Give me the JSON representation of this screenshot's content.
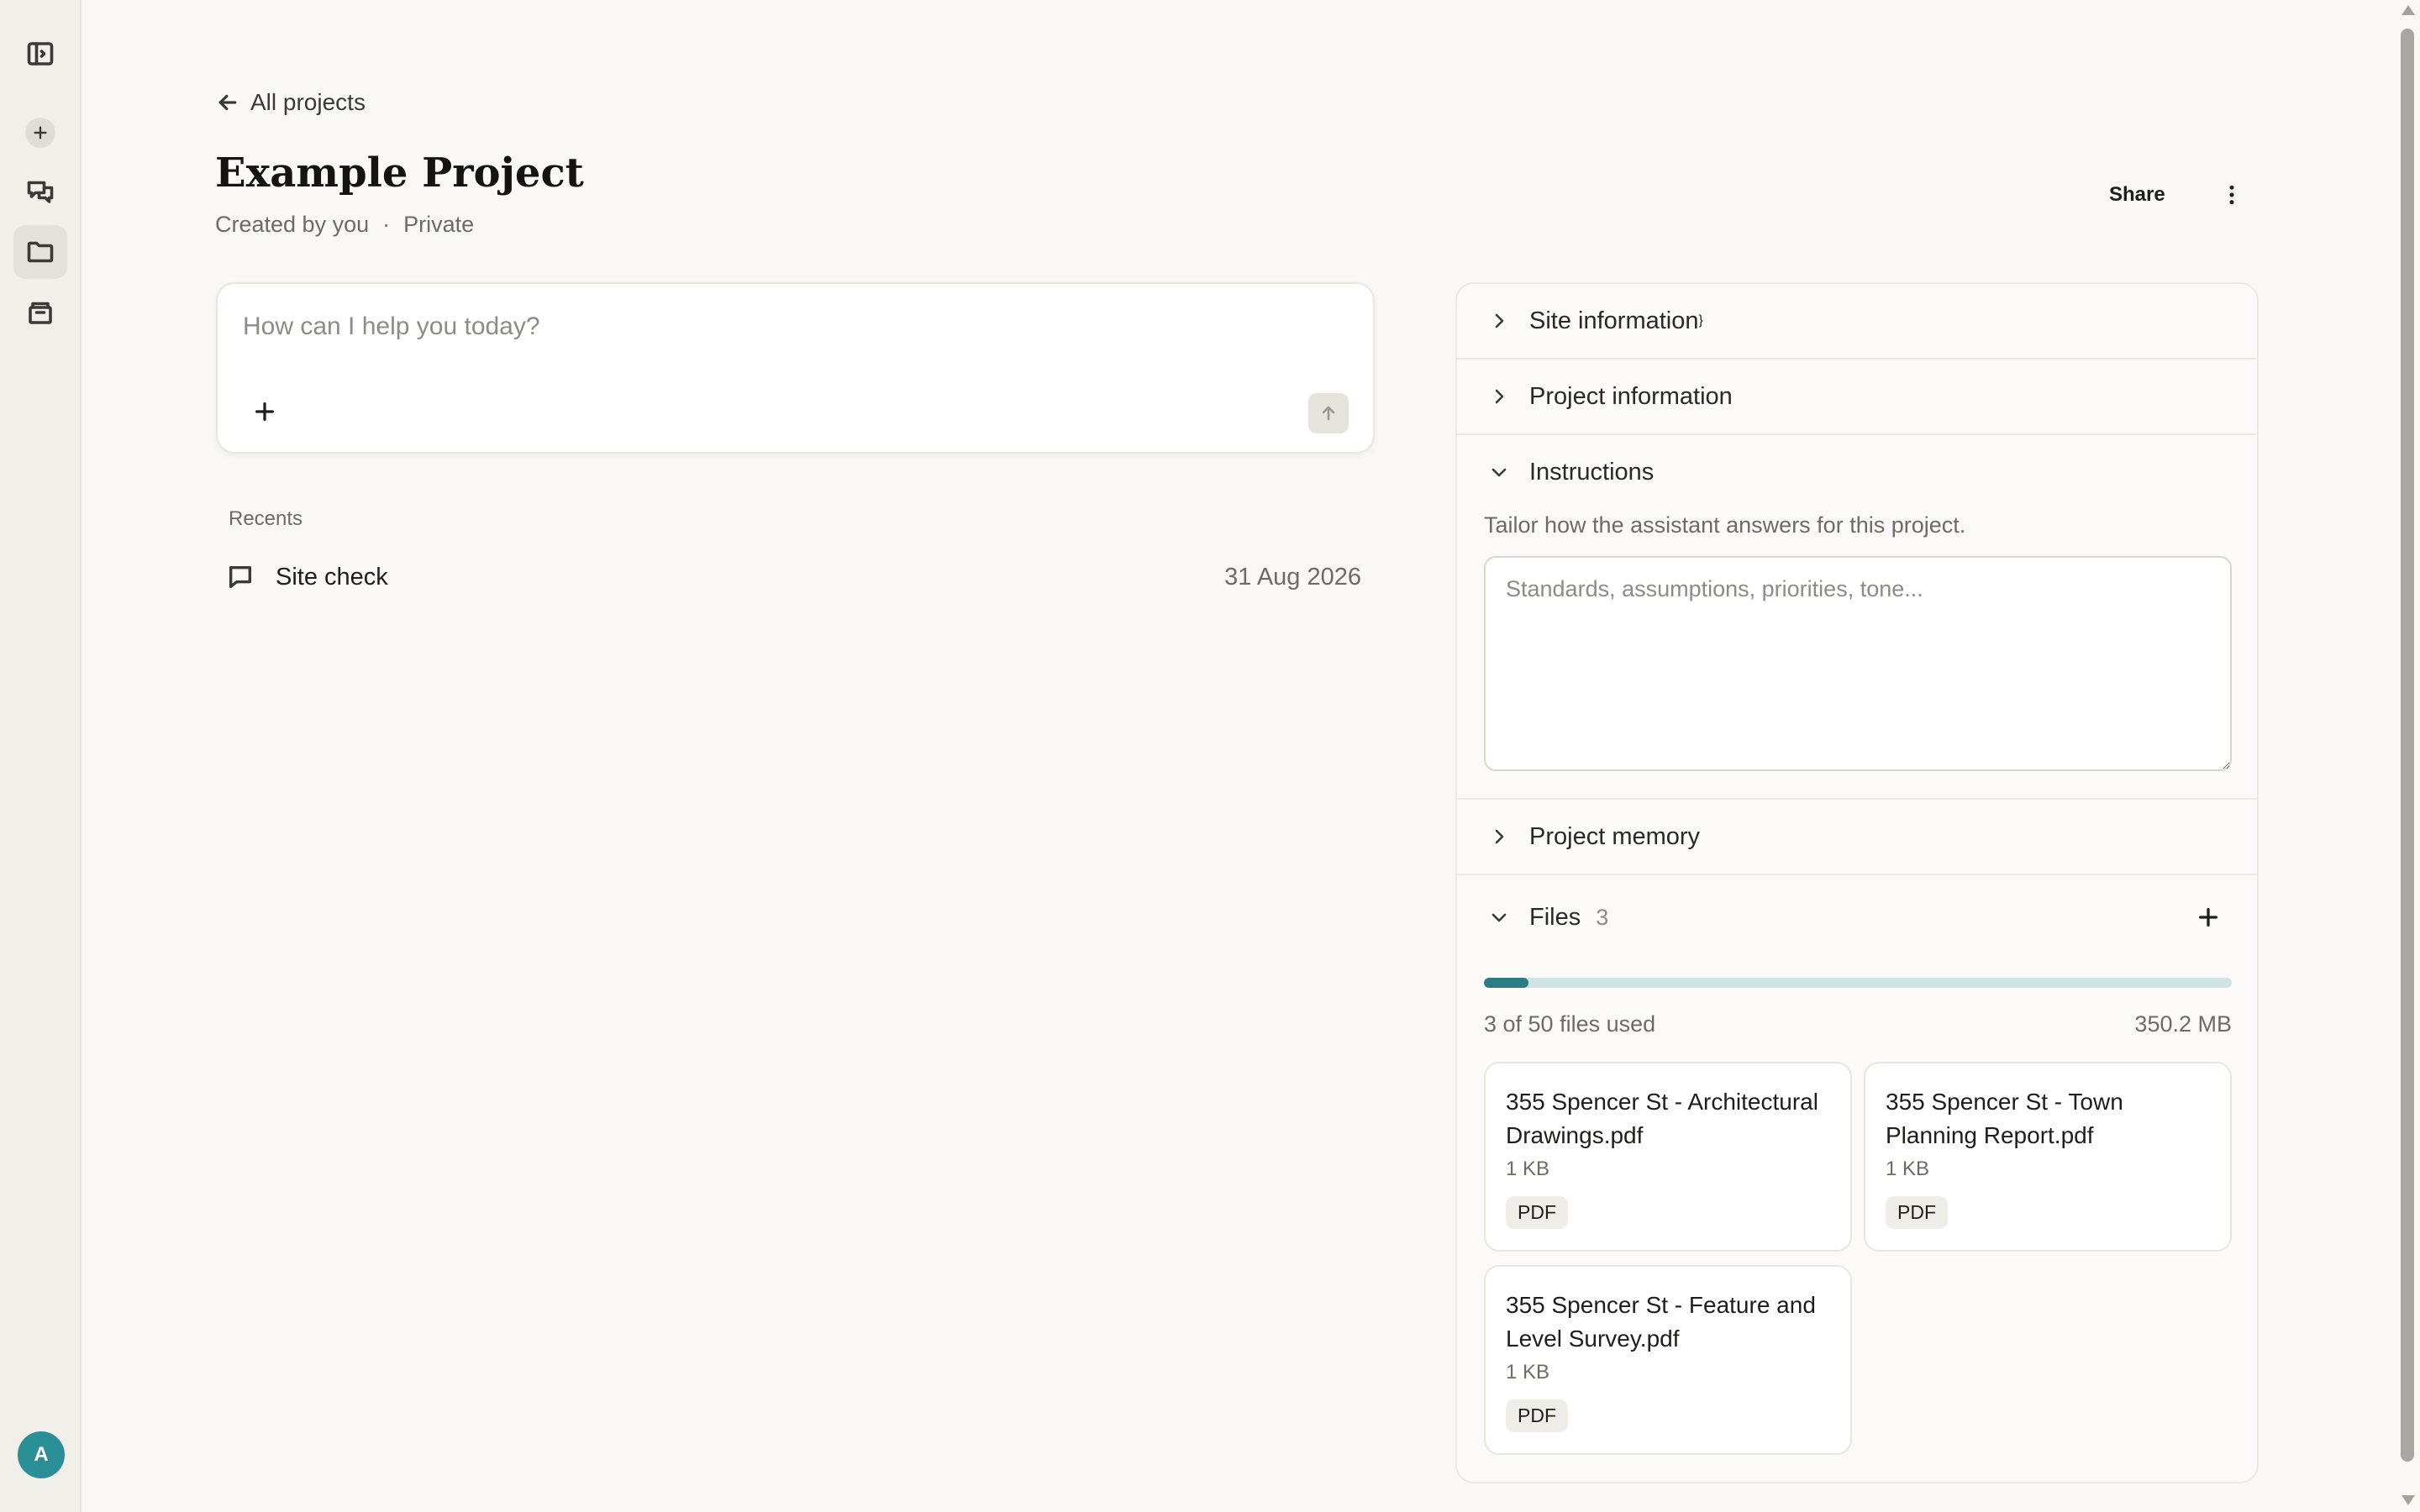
{
  "app": {
    "accent_color": "#2b8f98",
    "progress_color": "#2b7c85"
  },
  "sidebar": {
    "items": [
      {
        "icon": "sidebar-toggle-icon",
        "label": ""
      },
      {
        "icon": "plus-icon",
        "label": ""
      },
      {
        "icon": "chats-icon",
        "label": ""
      },
      {
        "icon": "folder-icon",
        "label": "",
        "active": true
      },
      {
        "icon": "archive-box-icon",
        "label": ""
      }
    ],
    "avatar_initial": "A"
  },
  "header": {
    "back_label": "All projects",
    "title": "Example Project",
    "created_by": "Created by you",
    "separator": "·",
    "visibility": "Private",
    "share_label": "Share"
  },
  "composer": {
    "placeholder": "How can I help you today?",
    "value": ""
  },
  "recents": {
    "label": "Recents",
    "items": [
      {
        "title": "Site check",
        "date": "31 Aug 2026"
      }
    ]
  },
  "panel": {
    "sections": {
      "site_info": {
        "title": "Site information",
        "expanded": false
      },
      "project_info": {
        "title": "Project information",
        "expanded": false
      },
      "instructions": {
        "title": "Instructions",
        "expanded": true,
        "description": "Tailor how the assistant answers for this project.",
        "placeholder": "Standards, assumptions, priorities, tone...",
        "value": ""
      },
      "memory": {
        "title": "Project memory",
        "expanded": false
      },
      "files": {
        "title": "Files",
        "count": "3",
        "expanded": true,
        "usage_text": "3 of 50 files used",
        "used": 3,
        "limit": 50,
        "total_size": "350.2 MB",
        "items": [
          {
            "name": "355 Spencer St - Architectural Drawings.pdf",
            "size": "1 KB",
            "type": "PDF"
          },
          {
            "name": "355 Spencer St - Town Planning Report.pdf",
            "size": "1 KB",
            "type": "PDF"
          },
          {
            "name": "355 Spencer St - Feature and Level Survey.pdf",
            "size": "1 KB",
            "type": "PDF"
          }
        ]
      }
    }
  }
}
